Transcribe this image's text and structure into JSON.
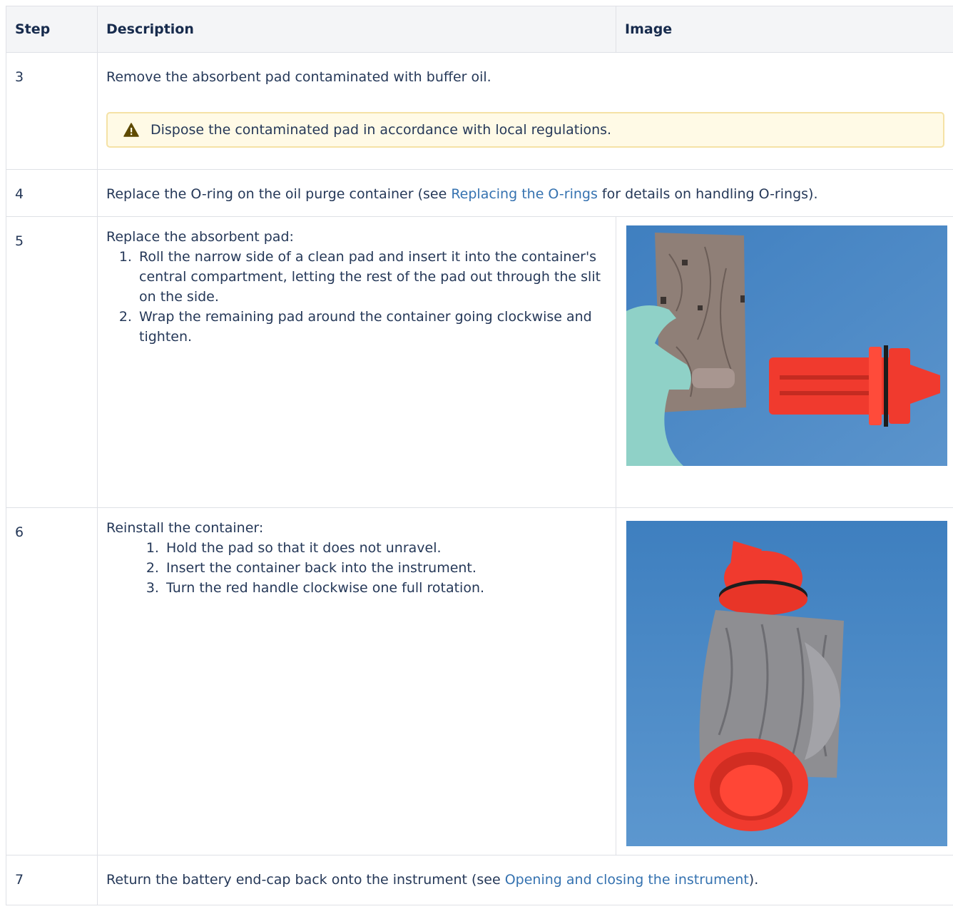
{
  "headers": {
    "step": "Step",
    "description": "Description",
    "image": "Image"
  },
  "rows": [
    {
      "step": "3",
      "text": "Remove the absorbent pad contaminated with buffer oil.",
      "warning": "Dispose the contaminated pad in accordance with local regulations."
    },
    {
      "step": "4",
      "text_before": "Replace the O-ring on the oil purge container (see ",
      "link": "Replacing the O-rings",
      "text_after": " for details on handling O-rings)."
    },
    {
      "step": "5",
      "intro": "Replace the absorbent pad:",
      "items": [
        "Roll the narrow side of a clean pad and insert it into the container's central compartment, letting the rest of the pad out through the slit on the side.",
        "Wrap the remaining pad around the container going clockwise and tighten."
      ]
    },
    {
      "step": "6",
      "intro": "Reinstall the container:",
      "items": [
        "Hold the pad so that it does not unravel.",
        "Insert the container back into the instrument.",
        "Turn the red handle clockwise one full rotation."
      ]
    },
    {
      "step": "7",
      "text_before": "Return the battery end-cap back onto the instrument (see ",
      "link": "Opening and closing the instrument",
      "text_after": ")."
    }
  ],
  "colors": {
    "link": "#3572b0",
    "warning_bg": "#fffae6",
    "warning_icon": "#5e4a00",
    "photo_bg": "#4a86c4",
    "container_red": "#f03a2e"
  },
  "icons": {
    "warning": "warning-triangle-icon"
  }
}
